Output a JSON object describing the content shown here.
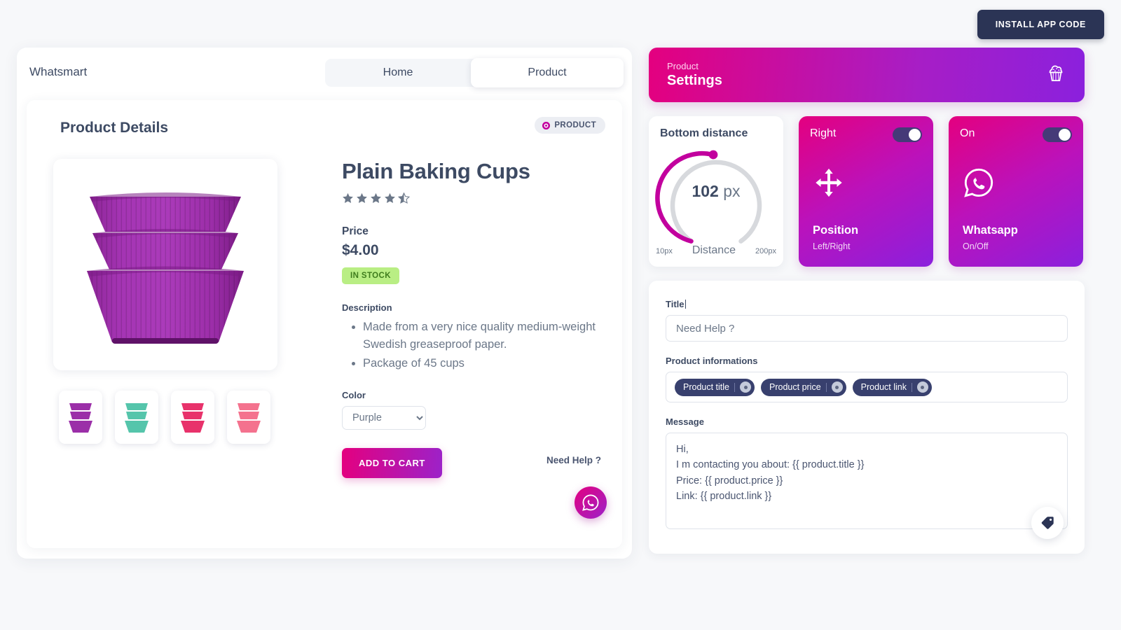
{
  "topbar": {
    "install_label": "INSTALL APP CODE"
  },
  "preview": {
    "brand": "Whatsmart",
    "tabs": [
      {
        "label": "Home",
        "active": false
      },
      {
        "label": "Product",
        "active": true
      }
    ],
    "details_title": "Product Details",
    "badge": {
      "label": "PRODUCT",
      "icon": "dot-icon"
    },
    "product": {
      "title": "Plain Baking Cups",
      "rating": 4.5,
      "price_label": "Price",
      "price": "$4.00",
      "stock": "IN STOCK",
      "description_label": "Description",
      "description": [
        "Made from a very nice quality medium-weight Swedish greaseproof paper.",
        "Package of 45 cups"
      ],
      "color_label": "Color",
      "color_selected": "Purple",
      "color_options": [
        "Purple",
        "Green",
        "Red",
        "Pink"
      ],
      "add_to_cart": "ADD TO CART",
      "thumb_colors": [
        "#9b2fa8",
        "#55c5ab",
        "#e8326b",
        "#f4728e"
      ],
      "main_color": "#9b2fa8"
    },
    "widget": {
      "need_help": "Need Help ?",
      "icon": "whatsapp-icon"
    }
  },
  "settings": {
    "header": {
      "eyebrow": "Product",
      "title": "Settings",
      "icon": "cupcake-icon"
    },
    "gauge": {
      "title": "Bottom distance",
      "value": "102",
      "unit": "px",
      "min_label": "10px",
      "max_label": "200px",
      "mid_label": "Distance",
      "min": 10,
      "max": 200,
      "current": 102,
      "fill_color": "#c2009e",
      "track_color": "#d7d9dd"
    },
    "cards": [
      {
        "state": "Right",
        "name": "Position",
        "sub": "Left/Right",
        "icon": "move-arrows-icon",
        "toggle_on": true
      },
      {
        "state": "On",
        "name": "Whatsapp",
        "sub": "On/Off",
        "icon": "whatsapp-icon",
        "toggle_on": true
      }
    ],
    "form": {
      "title_label": "Title",
      "title_value": "Need Help ?",
      "info_label": "Product informations",
      "chips": [
        "Product title",
        "Product price",
        "Product link"
      ],
      "message_label": "Message",
      "message_value": "Hi,\nI m contacting you about: {{ product.title }}\nPrice: {{ product.price }}\nLink: {{ product.link }}"
    },
    "tag_fab": {
      "icon": "tag-icon"
    }
  }
}
